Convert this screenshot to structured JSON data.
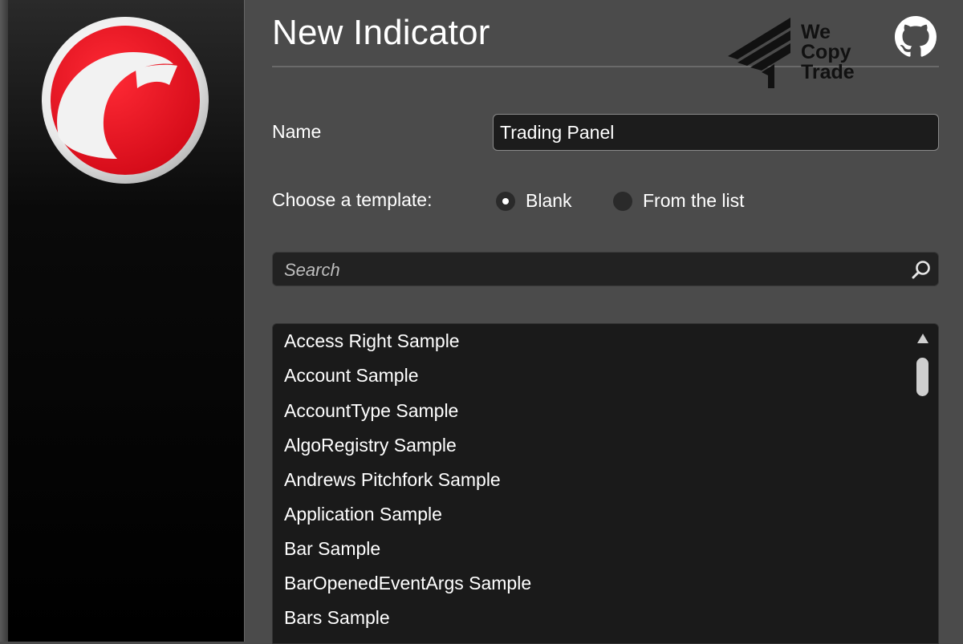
{
  "dialog": {
    "title": "New Indicator"
  },
  "brand": {
    "line1": "We",
    "line2": "Copy",
    "line3": "Trade",
    "mark": "wecopytrade-logo"
  },
  "icons": {
    "app_logo": "app-logo-icon",
    "github": "github-icon",
    "search": "search-icon"
  },
  "form": {
    "name_label": "Name",
    "name_value": "Trading Panel",
    "template_label": "Choose a template:",
    "template_options": [
      {
        "label": "Blank",
        "selected": true
      },
      {
        "label": "From the list",
        "selected": false
      }
    ],
    "search_placeholder": "Search"
  },
  "templates": [
    "Access Right Sample",
    "Account Sample",
    "AccountType Sample",
    "AlgoRegistry Sample",
    "Andrews Pitchfork Sample",
    "Application Sample",
    "Bar Sample",
    "BarOpenedEventArgs Sample",
    "Bars Sample"
  ],
  "colors": {
    "accent_red": "#e5101f",
    "background": "#4b4b4b",
    "panel": "#1a1a1a"
  }
}
